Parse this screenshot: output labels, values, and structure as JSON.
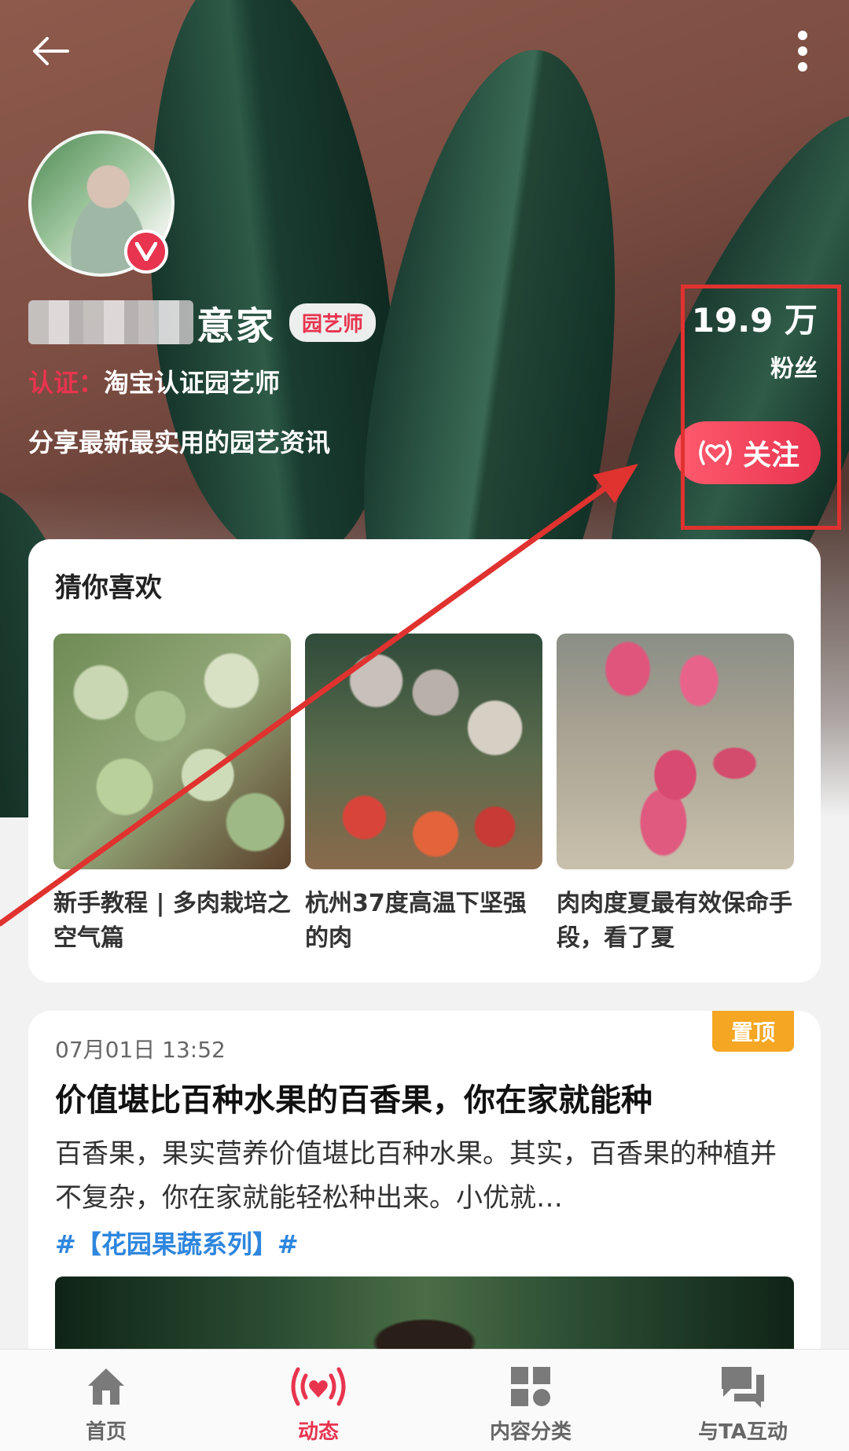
{
  "header": {
    "back_icon": "arrow-left-icon",
    "more_icon": "more-vertical-icon"
  },
  "profile": {
    "name_visible": "意家",
    "role_tag": "园艺师",
    "cert_label": "认证：",
    "cert_value": "淘宝认证园艺师",
    "intro": "分享最新最实用的园艺资讯",
    "fans_count": "19.9 万",
    "fans_label": "粉丝",
    "follow_label": "关注",
    "verified_icon": "v-badge-icon"
  },
  "recommend": {
    "title": "猜你喜欢",
    "items": [
      {
        "caption": "新手教程 | 多肉栽培之空气篇"
      },
      {
        "caption": "杭州37度高温下坚强的肉"
      },
      {
        "caption": "肉肉度夏最有效保命手段，看了夏"
      }
    ]
  },
  "post": {
    "date": "07月01日 13:52",
    "pin_label": "置顶",
    "title": "价值堪比百种水果的百香果，你在家就能种",
    "body": "百香果，果实营养价值堪比百种水果。其实，百香果的种植并不复杂，你在家就能轻松种出来。小优就…",
    "tag": "#【花园果蔬系列】#"
  },
  "tabbar": {
    "items": [
      {
        "label": "首页",
        "icon": "home-icon"
      },
      {
        "label": "动态",
        "icon": "heart-broadcast-icon",
        "active": true
      },
      {
        "label": "内容分类",
        "icon": "grid-icon"
      },
      {
        "label": "与TA互动",
        "icon": "chat-icon"
      }
    ]
  },
  "colors": {
    "accent": "#e8344f",
    "pin": "#f5a623",
    "tag_link": "#2e86de",
    "highlight": "#e0322f"
  }
}
